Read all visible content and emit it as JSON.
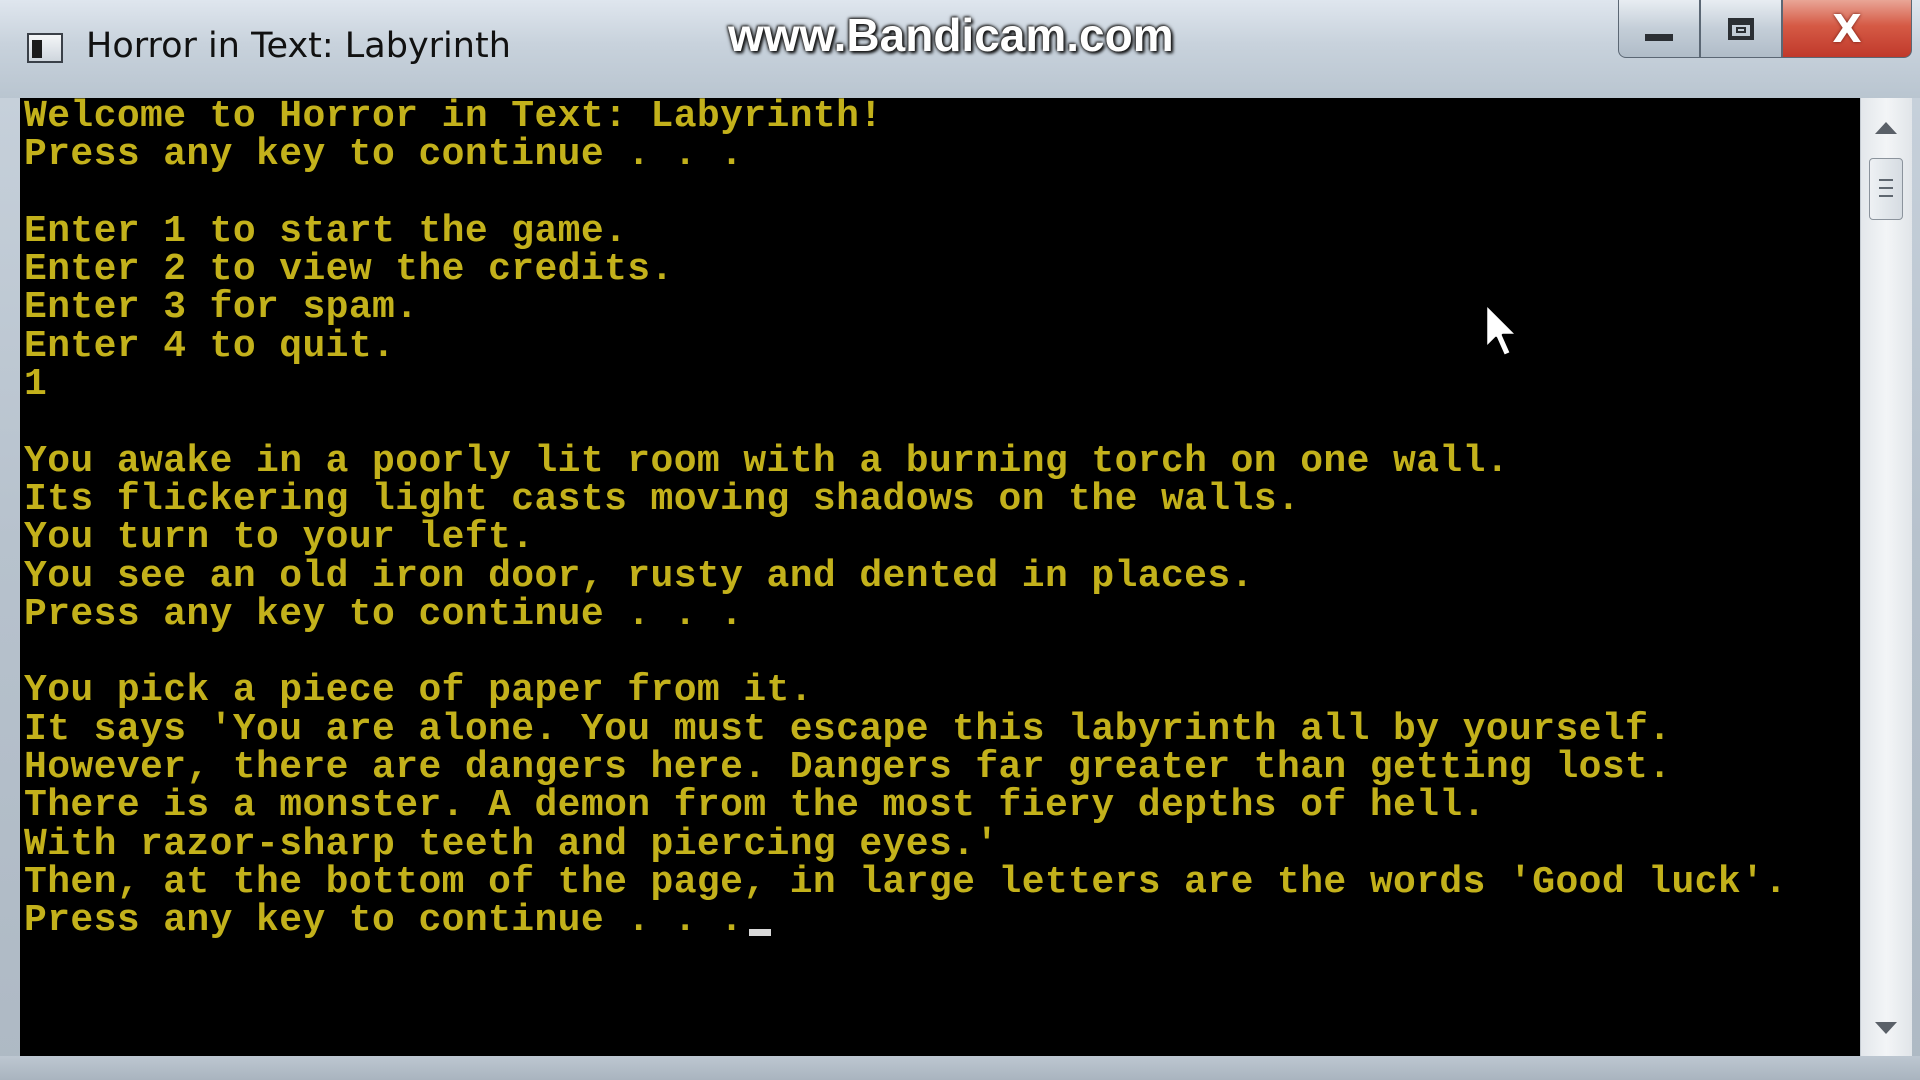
{
  "window": {
    "title": "Horror in Text: Labyrinth",
    "watermark": "www.Bandicam.com",
    "close_label": "X"
  },
  "console": {
    "text_color": "#c3b11b",
    "background": "#000000",
    "lines": [
      "Welcome to Horror in Text: Labyrinth!",
      "Press any key to continue . . .",
      "",
      "Enter 1 to start the game.",
      "Enter 2 to view the credits.",
      "Enter 3 for spam.",
      "Enter 4 to quit.",
      "1",
      "",
      "You awake in a poorly lit room with a burning torch on one wall.",
      "Its flickering light casts moving shadows on the walls.",
      "You turn to your left.",
      "You see an old iron door, rusty and dented in places.",
      "Press any key to continue . . .",
      "",
      "You pick a piece of paper from it.",
      "It says 'You are alone. You must escape this labyrinth all by yourself.",
      "However, there are dangers here. Dangers far greater than getting lost.",
      "There is a monster. A demon from the most fiery depths of hell.",
      "With razor-sharp teeth and piercing eyes.'",
      "Then, at the bottom of the page, in large letters are the words 'Good luck'.",
      "Press any key to continue . . ."
    ]
  },
  "icons": {
    "app": "console-app-icon",
    "minimize": "minimize-icon",
    "maximize": "maximize-icon",
    "close": "close-icon",
    "scroll_up": "arrow-up-icon",
    "scroll_down": "arrow-down-icon",
    "pointer": "mouse-pointer-icon"
  }
}
